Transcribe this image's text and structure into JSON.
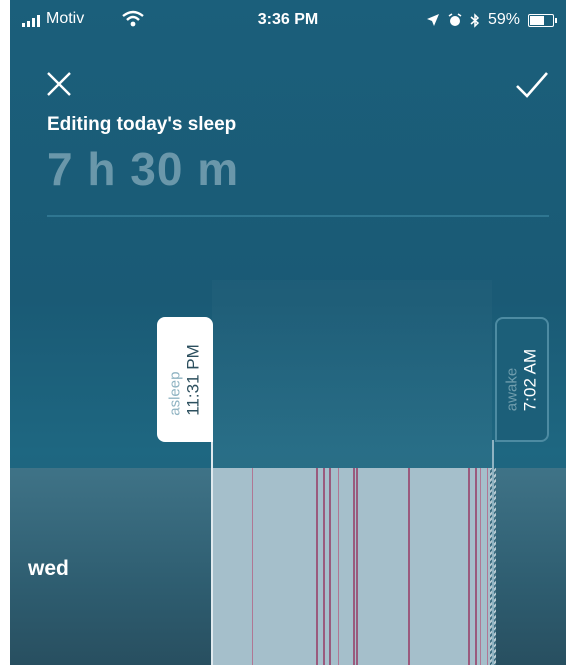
{
  "status_bar": {
    "carrier": "Motiv",
    "time": "3:36 PM",
    "battery": "59%",
    "battery_level": 0.59,
    "icons": [
      "signal-icon",
      "wifi-icon",
      "location-icon",
      "alarm-icon",
      "bluetooth-icon",
      "battery-icon"
    ]
  },
  "header": {
    "close_icon": "close-icon",
    "confirm_icon": "checkmark-icon",
    "title": "Editing today's sleep",
    "duration": "7 h 30 m"
  },
  "timeline": {
    "day_label": "wed",
    "asleep": {
      "label": "asleep",
      "time": "11:31 PM"
    },
    "awake": {
      "label": "awake",
      "time": "7:02 AM"
    }
  },
  "colors": {
    "background": "#1b5f7b",
    "sleep_block": "#a5bfcb",
    "restless_stripe": "#9a5a7d",
    "duration_text": "#6a97aa"
  }
}
